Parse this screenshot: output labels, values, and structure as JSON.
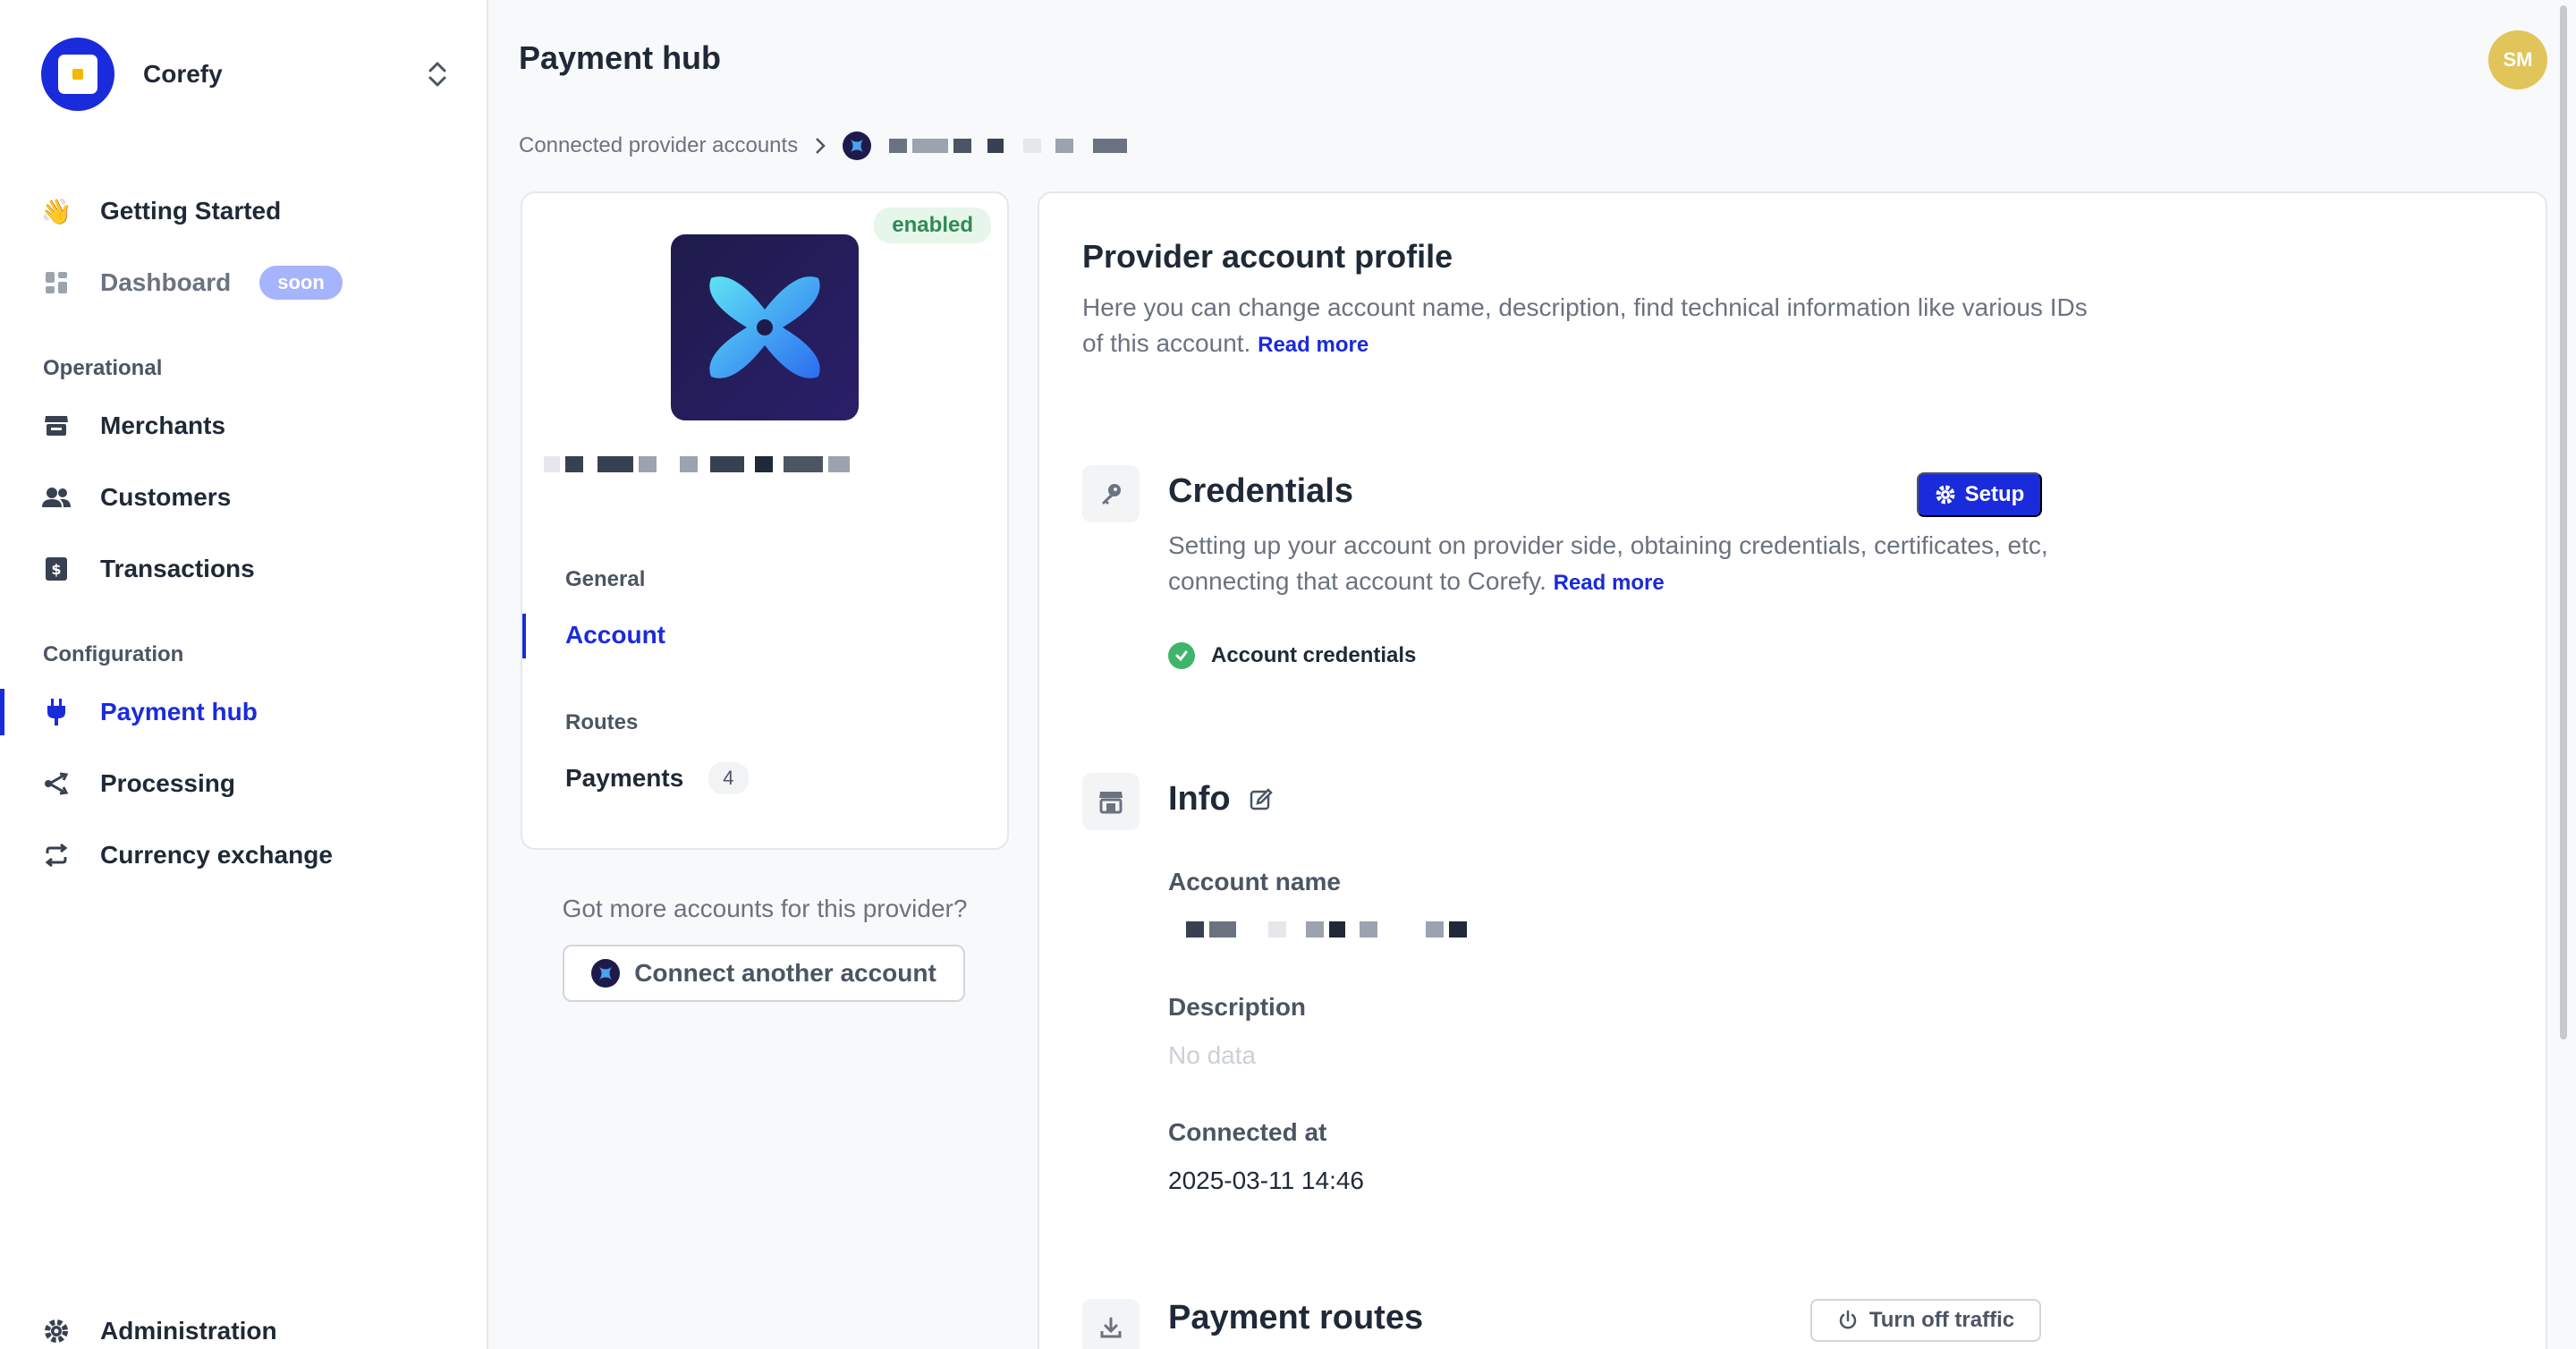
{
  "brand": {
    "name": "Corefy"
  },
  "sidebar": {
    "items": [
      {
        "label": "Getting Started"
      },
      {
        "label": "Dashboard",
        "badge": "soon"
      },
      {
        "label": "Merchants"
      },
      {
        "label": "Customers"
      },
      {
        "label": "Transactions"
      },
      {
        "label": "Payment hub"
      },
      {
        "label": "Processing"
      },
      {
        "label": "Currency exchange"
      },
      {
        "label": "Administration"
      }
    ],
    "sections": {
      "operational": "Operational",
      "configuration": "Configuration"
    }
  },
  "header": {
    "title": "Payment hub",
    "avatar_initials": "SM"
  },
  "breadcrumb": {
    "parent": "Connected provider accounts"
  },
  "provider_card": {
    "status_badge": "enabled",
    "general_section": "General",
    "account_item": "Account",
    "routes_section": "Routes",
    "payments_item": "Payments",
    "payments_count": "4"
  },
  "more_accounts": {
    "prompt": "Got more accounts for this provider?",
    "button_label": "Connect another account"
  },
  "profile": {
    "title": "Provider account profile",
    "description": "Here you can change account name, description, find technical information like various IDs of this account.",
    "read_more": "Read more"
  },
  "credentials": {
    "title": "Credentials",
    "setup_label": "Setup",
    "description": "Setting up your account on provider side, obtaining credentials, certificates, etc, connecting that account to Corefy.",
    "read_more": "Read more",
    "status_item": "Account credentials"
  },
  "info": {
    "title": "Info",
    "account_name_label": "Account name",
    "description_label": "Description",
    "description_value": "No data",
    "connected_at_label": "Connected at",
    "connected_at_value": "2025-03-11 14:46"
  },
  "payment_routes": {
    "title": "Payment routes",
    "traffic_button": "Turn off traffic"
  },
  "colors": {
    "accent": "#1a2bdb",
    "success": "#3fb56b",
    "avatar": "#e1c45a"
  }
}
